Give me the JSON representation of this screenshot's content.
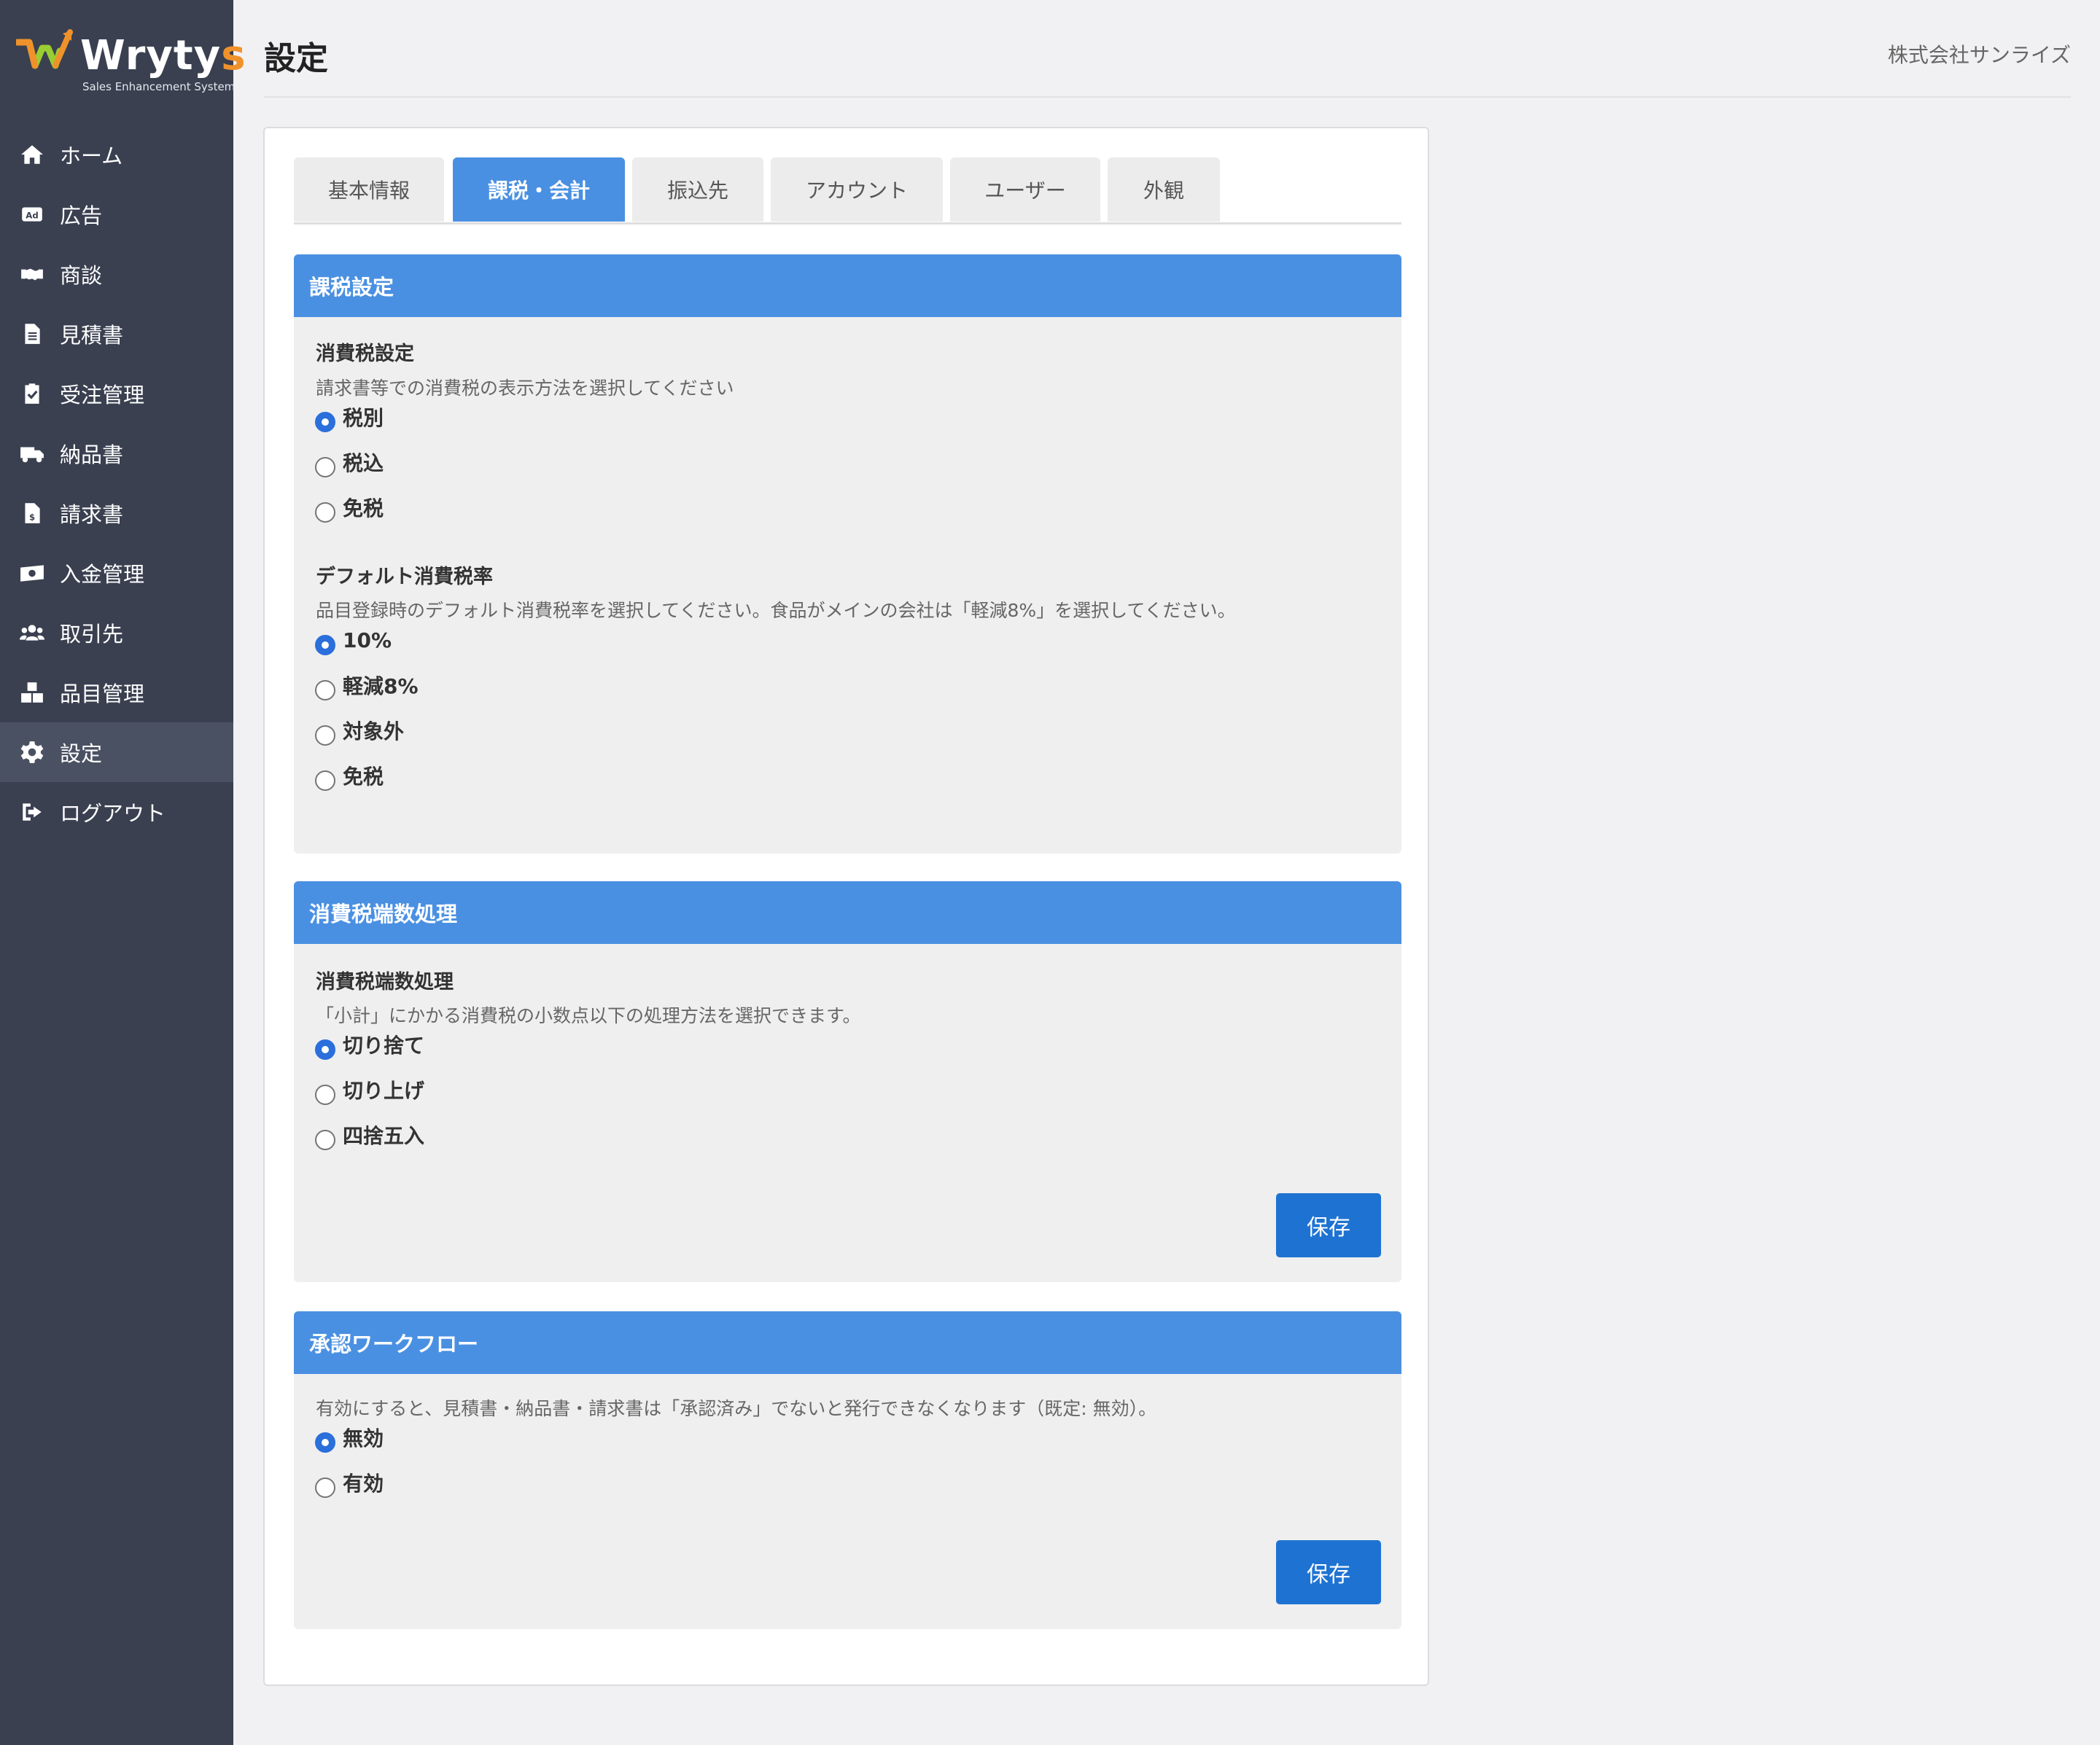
{
  "brand": {
    "name_main": "Wryty",
    "name_accent": "s",
    "tagline": "Sales Enhancement System"
  },
  "sidebar": {
    "items": [
      {
        "label": "ホーム",
        "icon": "home-icon",
        "active": false
      },
      {
        "label": "広告",
        "icon": "ad-icon",
        "active": false
      },
      {
        "label": "商談",
        "icon": "handshake-icon",
        "active": false
      },
      {
        "label": "見積書",
        "icon": "document-icon",
        "active": false
      },
      {
        "label": "受注管理",
        "icon": "clipboard-check-icon",
        "active": false
      },
      {
        "label": "納品書",
        "icon": "truck-icon",
        "active": false
      },
      {
        "label": "請求書",
        "icon": "invoice-icon",
        "active": false
      },
      {
        "label": "入金管理",
        "icon": "money-icon",
        "active": false
      },
      {
        "label": "取引先",
        "icon": "users-icon",
        "active": false
      },
      {
        "label": "品目管理",
        "icon": "boxes-icon",
        "active": false
      },
      {
        "label": "設定",
        "icon": "gear-icon",
        "active": true
      },
      {
        "label": "ログアウト",
        "icon": "sign-out-icon",
        "active": false
      }
    ]
  },
  "header": {
    "title": "設定",
    "company": "株式会社サンライズ"
  },
  "tabs": [
    {
      "label": "基本情報",
      "active": false
    },
    {
      "label": "課税・会計",
      "active": true
    },
    {
      "label": "振込先",
      "active": false
    },
    {
      "label": "アカウント",
      "active": false
    },
    {
      "label": "ユーザー",
      "active": false
    },
    {
      "label": "外観",
      "active": false
    }
  ],
  "tax_settings": {
    "heading": "課税設定",
    "consumption_tax": {
      "label": "消費税設定",
      "help": "請求書等での消費税の表示方法を選択してください",
      "options": [
        "税別",
        "税込",
        "免税"
      ],
      "selected": "税別"
    },
    "default_rate": {
      "label": "デフォルト消費税率",
      "help": "品目登録時のデフォルト消費税率を選択してください。食品がメインの会社は「軽減8%」を選択してください。",
      "options": [
        "10%",
        "軽減8%",
        "対象外",
        "免税"
      ],
      "selected": "10%"
    }
  },
  "rounding": {
    "heading": "消費税端数処理",
    "label": "消費税端数処理",
    "help": "「小計」にかかる消費税の小数点以下の処理方法を選択できます。",
    "options": [
      "切り捨て",
      "切り上げ",
      "四捨五入"
    ],
    "selected": "切り捨て",
    "save_label": "保存"
  },
  "workflow": {
    "heading": "承認ワークフロー",
    "help": "有効にすると、見積書・納品書・請求書は「承認済み」でないと発行できなくなります（既定: 無効）。",
    "options": [
      "無効",
      "有効"
    ],
    "selected": "無効",
    "save_label": "保存"
  },
  "colors": {
    "sidebar_bg": "#3a4050",
    "sidebar_active": "#4a5162",
    "section_header": "#4a90e2",
    "save_button": "#1e73d2",
    "radio_checked": "#2a6fdb",
    "brand_accent": "#f0922b"
  }
}
